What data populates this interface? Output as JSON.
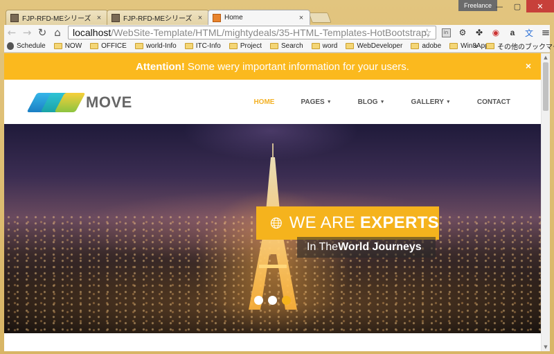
{
  "window": {
    "user_badge": "Freelance",
    "min_glyph": "—",
    "max_glyph": "▢",
    "close_glyph": "✕"
  },
  "tabs": [
    {
      "label": "FJP-RFD-MEシリーズ【従",
      "active": false
    },
    {
      "label": "FJP-RFD-MEシリーズ【従",
      "active": false
    },
    {
      "label": "Home",
      "active": true
    }
  ],
  "toolbar": {
    "url_host": "localhost",
    "url_path": "/WebSite-Template/HTML/mightydeals/35-HTML-Templates-HotBootstrap,",
    "back_glyph": "←",
    "forward_glyph": "→",
    "reload_glyph": "↻",
    "home_glyph": "⌂",
    "star_glyph": "☆",
    "menu_glyph": "≡",
    "extensions": [
      "in",
      "gear-icon",
      "puzzle-icon",
      "adblock-icon",
      "amazon-icon",
      "translate-icon",
      "menu-icon"
    ]
  },
  "bookmarks": {
    "items": [
      "Schedule",
      "NOW",
      "OFFICE",
      "world-Info",
      "ITC-Info",
      "Project",
      "Search",
      "word",
      "WebDeveloper",
      "adobe",
      "Win8App"
    ],
    "more": "»",
    "other": "その他のブックマーク"
  },
  "alert": {
    "strong": "Attention!",
    "text": "Some wery important information for your users.",
    "close": "×"
  },
  "navbar": {
    "brand": "MOVE",
    "menu": [
      {
        "label": "HOME",
        "caret": false,
        "active": true
      },
      {
        "label": "PAGES",
        "caret": true,
        "active": false
      },
      {
        "label": "BLOG",
        "caret": true,
        "active": false
      },
      {
        "label": "GALLERY",
        "caret": true,
        "active": false
      },
      {
        "label": "CONTACT",
        "caret": false,
        "active": false
      }
    ]
  },
  "hero": {
    "title_light": "WE ARE ",
    "title_bold": "EXPERTS",
    "sub_light": "In The ",
    "sub_bold": "World Journeys",
    "slides": 3,
    "active_slide": 2
  },
  "colors": {
    "accent": "#f5b31d",
    "alert_bg": "#fbb91e",
    "nav_active": "#f3b125",
    "frame": "#d9b76a"
  }
}
